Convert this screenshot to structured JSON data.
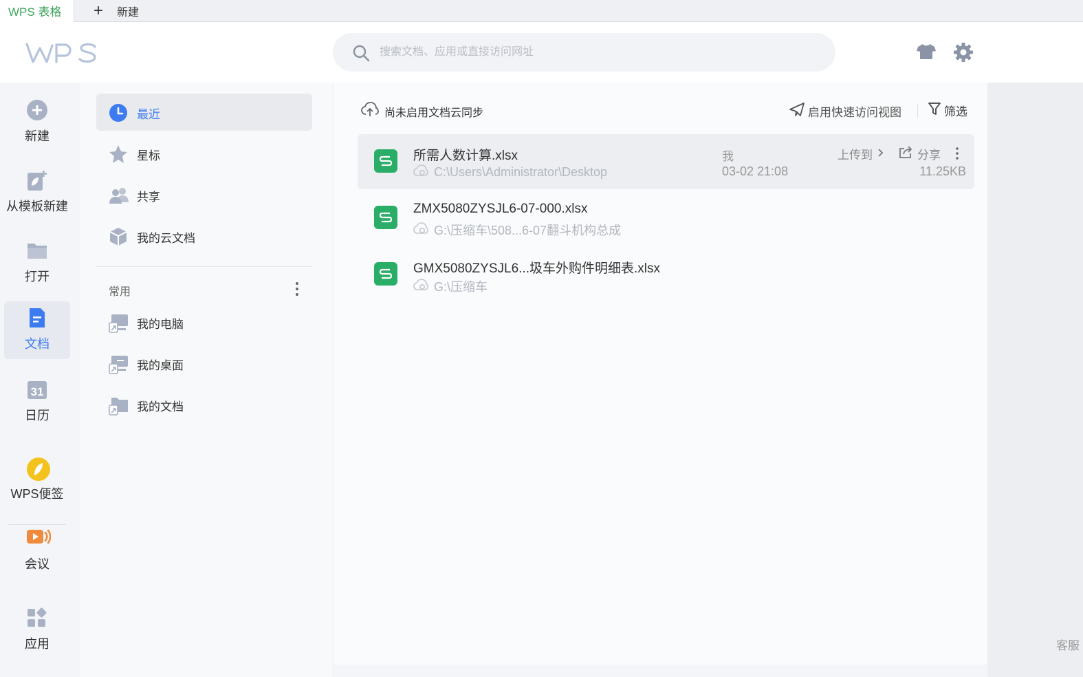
{
  "tabs": {
    "active_label": "WPS 表格",
    "new_label": "新建"
  },
  "search": {
    "placeholder": "搜索文档、应用或直接访问网址"
  },
  "rail": {
    "items": [
      {
        "label": "新建"
      },
      {
        "label": "从模板新建"
      },
      {
        "label": "打开"
      },
      {
        "label": "文档"
      },
      {
        "label": "日历"
      },
      {
        "label": "WPS便签"
      },
      {
        "label": "会议"
      },
      {
        "label": "应用"
      }
    ],
    "calendar_day": "31"
  },
  "nav": {
    "items": [
      {
        "label": "最近"
      },
      {
        "label": "星标"
      },
      {
        "label": "共享"
      },
      {
        "label": "我的云文档"
      }
    ],
    "group_label": "常用",
    "common": [
      {
        "label": "我的电脑"
      },
      {
        "label": "我的桌面"
      },
      {
        "label": "我的文档"
      }
    ]
  },
  "toolbar": {
    "sync_label": "尚未启用文档云同步",
    "quick_label": "启用快速访问视图",
    "filter_label": "筛选"
  },
  "files": [
    {
      "name": "所需人数计算.xlsx",
      "path": "C:\\Users\\Administrator\\Desktop",
      "owner": "我",
      "date": "03-02 21:08",
      "upload": "上传到",
      "share": "分享",
      "size": "11.25KB"
    },
    {
      "name": "ZMX5080ZYSJL6-07-000.xlsx",
      "path": "G:\\压缩车\\508...6-07翻斗机构总成"
    },
    {
      "name": "GMX5080ZYSJL6...圾车外购件明细表.xlsx",
      "path": "G:\\压缩车"
    }
  ],
  "corner_label": "客服",
  "colors": {
    "accent": "#3c7cf0",
    "sheet_green": "#2aae67",
    "tab_green": "#3fa55e"
  }
}
